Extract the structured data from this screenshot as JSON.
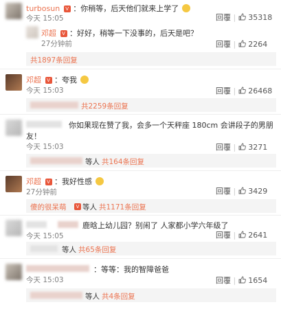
{
  "comments": [
    {
      "name": "turbosun",
      "text": "：你稍等，后天他们就来上学了",
      "time": "今天 15:05",
      "reply": "回覆",
      "likes": "35318"
    },
    {
      "name": "邓超",
      "text": "：好好，稍等一下没事的，后天是吧？",
      "time": "27分钟前",
      "reply": "回覆",
      "likes": "2264",
      "more": "共1897条回复"
    },
    {
      "name": "邓超",
      "text": "：夸我",
      "time": "今天 15:03",
      "reply": "回覆",
      "likes": "26468",
      "more": "共2259条回复"
    },
    {
      "name": "",
      "text": "你如果现在赞了我，会多一个天秤座 180cm 会讲段子的男朋友！",
      "text1": "你如果现在赞了我，会多一个天秤座 180cm 会讲段子的男朋",
      "text2": "友！",
      "time": "今天 15:03",
      "reply": "回覆",
      "likes": "3271",
      "more_prefix": "等人",
      "more": "共164条回复"
    },
    {
      "name": "邓超",
      "text": "：我好性感",
      "time": "27分钟前",
      "reply": "回覆",
      "likes": "3429",
      "more_user": "傻的很呆萌",
      "more_prefix": "等人",
      "more": "共1171条回复"
    },
    {
      "name": "",
      "text": "鹿晗上幼儿园？别闹了 人家都小学六年级了",
      "time": "今天 15:05",
      "reply": "回覆",
      "likes": "2641",
      "more_prefix": "等人",
      "more": "共65条回复"
    },
    {
      "name": "",
      "text": "：等等：我的智障爸爸",
      "time": "今天 15:03",
      "reply": "回覆",
      "likes": "1654",
      "more_prefix": "等人",
      "more": "共4条回复"
    }
  ]
}
